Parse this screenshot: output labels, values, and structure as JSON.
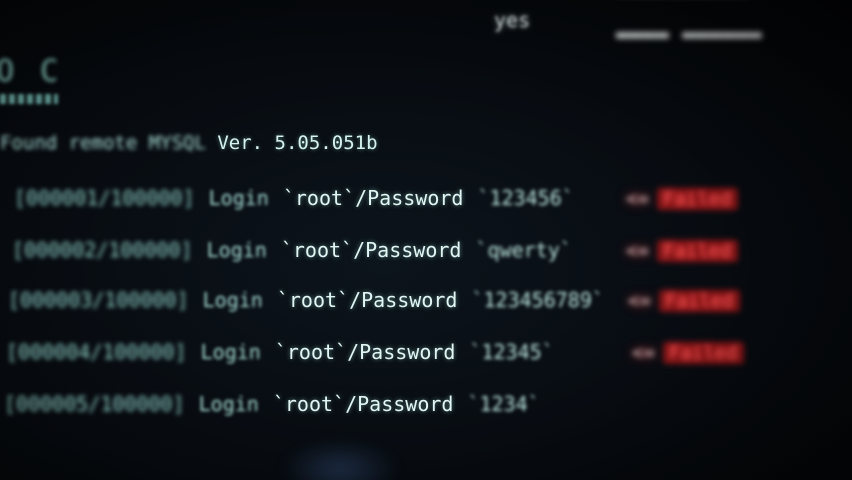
{
  "top": {
    "yes_text": "yes"
  },
  "left_fragment": "O C",
  "found_line": {
    "prefix": "Found remote MYSQL",
    "version": "Ver. 5.05.051b"
  },
  "attempts": [
    {
      "counter": "[000001/100000]",
      "login": "Login",
      "user_part": "`root`/Password",
      "password": "`123456`",
      "arrow": "<=",
      "status": "Failed"
    },
    {
      "counter": "[000002/100000]",
      "login": "Login",
      "user_part": "`root`/Password",
      "password": "`qwerty`",
      "arrow": "<=",
      "status": "Failed"
    },
    {
      "counter": "[000003/100000]",
      "login": "Login",
      "user_part": "`root`/Password",
      "password": "`123456789`",
      "arrow": "<=",
      "status": "Failed"
    },
    {
      "counter": "[000004/100000]",
      "login": "Login",
      "user_part": "`root`/Password",
      "password": "`12345`",
      "arrow": "<=",
      "status": "Failed"
    },
    {
      "counter": "[000005/100000]",
      "login": "Login",
      "user_part": "`root`/Password",
      "password": "`1234`"
    }
  ],
  "colors": {
    "terminal_text": "#c9ece8",
    "failed_status": "#ff3a3a",
    "background": "#070b10"
  }
}
